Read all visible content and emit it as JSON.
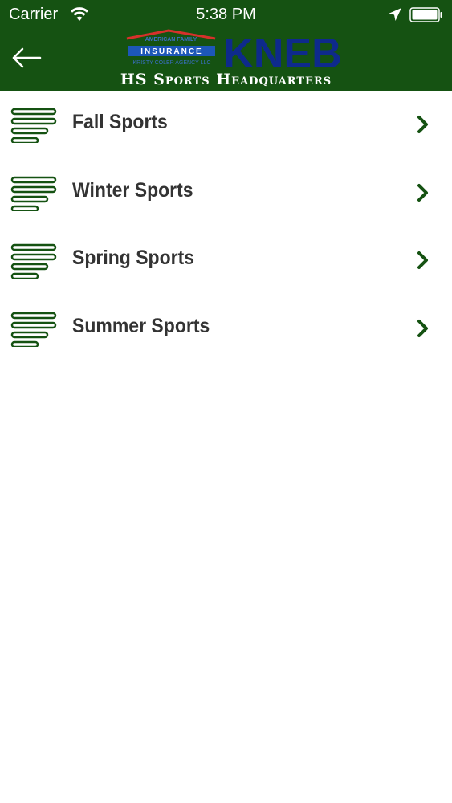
{
  "status_bar": {
    "carrier": "Carrier",
    "time": "5:38 PM"
  },
  "header": {
    "logo": {
      "insurance_line1": "AMERICAN FAMILY",
      "insurance_line2": "INSURANCE",
      "insurance_line3": "KRISTY COLER AGENCY LLC",
      "brand": "KNEB"
    },
    "subtitle": "HS Sports Headquarters",
    "accent_color": "#155212"
  },
  "menu": {
    "items": [
      {
        "label": "Fall Sports"
      },
      {
        "label": "Winter Sports"
      },
      {
        "label": "Spring Sports"
      },
      {
        "label": "Summer Sports"
      }
    ],
    "item_icon": "list-lines-icon",
    "chevron_icon": "chevron-right-icon"
  }
}
